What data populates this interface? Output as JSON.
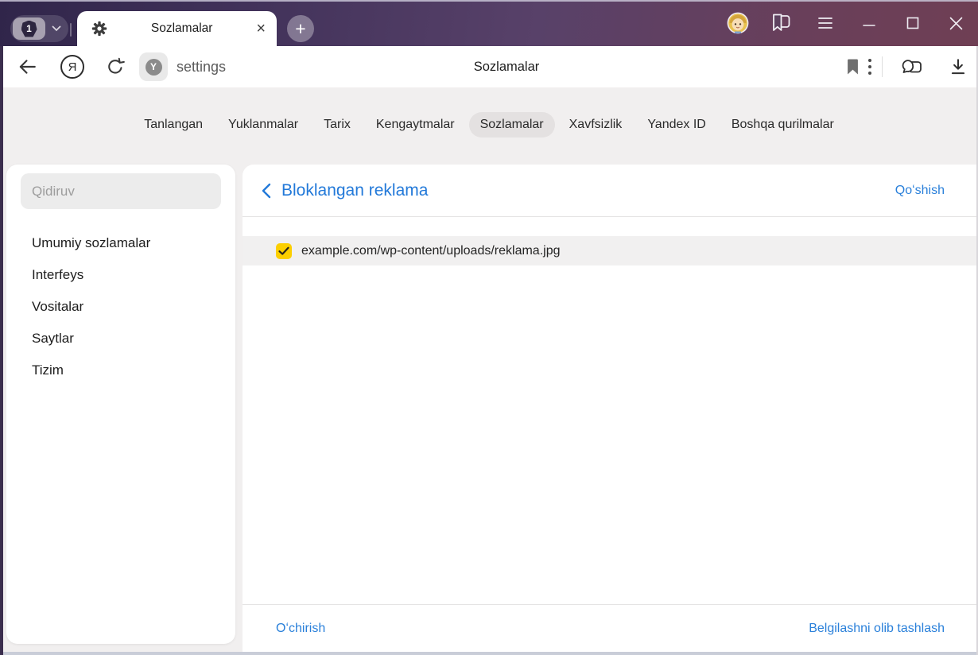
{
  "chrome": {
    "tab_counter": "1",
    "active_tab_title": "Sozlamalar",
    "new_tab_plus": "+",
    "tab_close": "×"
  },
  "toolbar": {
    "yandex_logo_letter": "Я",
    "site_icon_letter": "Y",
    "url_text": "settings",
    "page_title": "Sozlamalar"
  },
  "nav_tabs": [
    "Tanlangan",
    "Yuklanmalar",
    "Tarix",
    "Kengaytmalar",
    "Sozlamalar",
    "Xavfsizlik",
    "Yandex ID",
    "Boshqa qurilmalar"
  ],
  "nav_active_tab": "Sozlamalar",
  "sidebar": {
    "search_placeholder": "Qidiruv",
    "items": [
      "Umumiy sozlamalar",
      "Interfeys",
      "Vositalar",
      "Saytlar",
      "Tizim"
    ]
  },
  "content": {
    "heading": "Bloklangan reklama",
    "add_link": "Qoʻshish",
    "list": [
      {
        "url": "example.com/wp-content/uploads/reklama.jpg",
        "checked": true
      }
    ],
    "footer": {
      "delete_link": "Oʻchirish",
      "clear_selection_link": "Belgilashni olib tashlash"
    }
  },
  "colors": {
    "accent_blue": "#2279d9",
    "checkbox_yellow": "#fccf00",
    "chrome_left": "#30254a",
    "chrome_right": "#6f3f54"
  }
}
